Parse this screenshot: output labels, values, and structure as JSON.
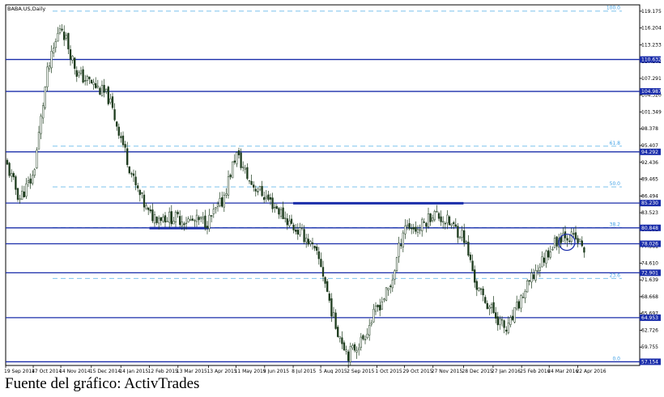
{
  "caption": "Fuente del gráfico: ActivTrades",
  "chart_data": {
    "type": "candlestick",
    "title": "BABA.US,Daily",
    "ylim": [
      56.5,
      120.3
    ],
    "y_ticks": [
      "119.175",
      "116.204",
      "113.233",
      "110.262",
      "107.291",
      "104.320",
      "101.349",
      "98.378",
      "95.407",
      "92.436",
      "89.465",
      "86.494",
      "83.523",
      "80.552",
      "77.581",
      "74.610",
      "71.639",
      "68.668",
      "65.697",
      "62.726",
      "59.755"
    ],
    "x_ticks": [
      "19 Sep 2014",
      "17 Oct 2014",
      "14 Nov 2014",
      "15 Dec 2014",
      "14 Jan 2015",
      "12 Feb 2015",
      "13 Mar 2015",
      "13 Apr 2015",
      "11 May 2015",
      "9 Jun 2015",
      "8 Jul 2015",
      "5 Aug 2015",
      "2 Sep 2015",
      "1 Oct 2015",
      "29 Oct 2015",
      "27 Nov 2015",
      "28 Dec 2015",
      "27 Jan 2016",
      "25 Feb 2016",
      "24 Mar 2016",
      "22 Apr 2016"
    ],
    "horizontal_levels": [
      "110.632",
      "104.987",
      "94.292",
      "85.230",
      "80.848",
      "78.026",
      "72.901",
      "64.953",
      "57.154"
    ],
    "fibonacci_levels": [
      {
        "label": "100.0",
        "value": 119.2
      },
      {
        "label": "61.8",
        "value": 95.3
      },
      {
        "label": "50.0",
        "value": 88.1
      },
      {
        "label": "38.2",
        "value": 80.9
      },
      {
        "label": "23.6",
        "value": 71.9
      },
      {
        "label": "0.0",
        "value": 57.15
      }
    ],
    "trend_segments": [
      {
        "x": [
          "12 Feb 2015",
          "13 Apr 2015"
        ],
        "y": 80.8
      },
      {
        "x": [
          "8 Jul 2015",
          "28 Dec 2015"
        ],
        "y": 85.2
      }
    ],
    "price_path": {
      "x": [
        "19 Sep 2014",
        "3 Oct 2014",
        "17 Oct 2014",
        "31 Oct 2014",
        "14 Nov 2014",
        "1 Dec 2014",
        "15 Dec 2014",
        "1 Jan 2015",
        "14 Jan 2015",
        "28 Jan 2015",
        "12 Feb 2015",
        "27 Feb 2015",
        "13 Mar 2015",
        "27 Mar 2015",
        "13 Apr 2015",
        "27 Apr 2015",
        "11 May 2015",
        "25 May 2015",
        "9 Jun 2015",
        "23 Jun 2015",
        "8 Jul 2015",
        "22 Jul 2015",
        "5 Aug 2015",
        "19 Aug 2015",
        "2 Sep 2015",
        "16 Sep 2015",
        "1 Oct 2015",
        "15 Oct 2015",
        "29 Oct 2015",
        "12 Nov 2015",
        "27 Nov 2015",
        "11 Dec 2015",
        "28 Dec 2015",
        "11 Jan 2016",
        "27 Jan 2016",
        "10 Feb 2016",
        "25 Feb 2016",
        "10 Mar 2016",
        "24 Mar 2016",
        "8 Apr 2016",
        "22 Apr 2016",
        "29 Apr 2016"
      ],
      "close": [
        92.5,
        86.0,
        90.0,
        108.0,
        117.0,
        108.0,
        106.5,
        104.0,
        97.0,
        88.5,
        83.0,
        82.8,
        82.5,
        82.0,
        82.0,
        85.5,
        94.0,
        89.0,
        86.5,
        84.0,
        81.0,
        79.0,
        74.5,
        64.0,
        58.5,
        61.0,
        66.5,
        70.5,
        81.5,
        80.5,
        83.5,
        82.0,
        79.5,
        70.0,
        66.0,
        62.5,
        68.5,
        73.0,
        77.0,
        80.0,
        78.5,
        77.0
      ]
    }
  }
}
